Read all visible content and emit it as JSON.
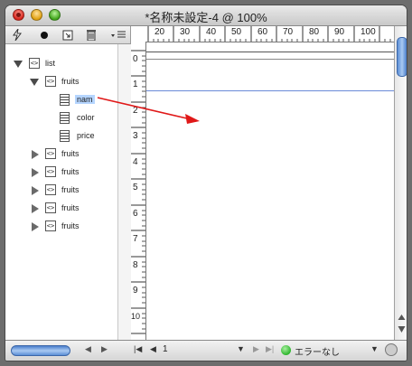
{
  "window": {
    "title": "*名称未設定-4 @ 100%"
  },
  "left_toolbar": {
    "icons": [
      "lightning-icon",
      "bullet-icon",
      "import-icon",
      "trash-icon",
      "menu-icon"
    ]
  },
  "tree": {
    "root": {
      "label": "list"
    },
    "fruits_expanded": {
      "label": "fruits"
    },
    "children": [
      {
        "label": "nam"
      },
      {
        "label": "color"
      },
      {
        "label": "price"
      }
    ],
    "collapsed_items": [
      {
        "label": "fruits"
      },
      {
        "label": "fruits"
      },
      {
        "label": "fruits"
      },
      {
        "label": "fruits"
      },
      {
        "label": "fruits"
      }
    ]
  },
  "ruler": {
    "h_labels": [
      "20",
      "30",
      "40",
      "50",
      "60",
      "70",
      "80",
      "90",
      "100"
    ],
    "v_labels": [
      "0",
      "1",
      "2",
      "3",
      "4",
      "5",
      "6",
      "7",
      "8",
      "9",
      "10"
    ]
  },
  "status": {
    "page_number": "1",
    "error_text": "エラーなし",
    "status_color": "#2db52d"
  },
  "colors": {
    "selection": "#b5d5ff",
    "arrow": "#e01818",
    "guide": "#6a8ad8"
  }
}
